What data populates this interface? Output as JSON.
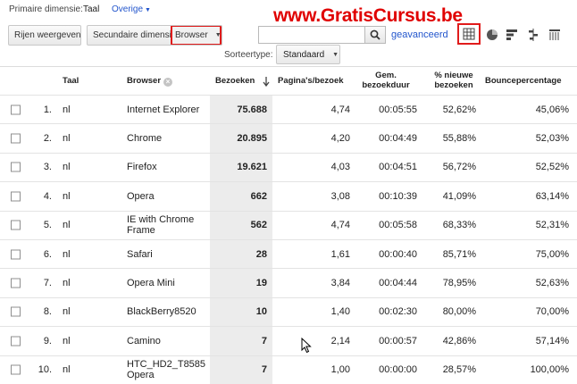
{
  "dimension_bar": {
    "label": "Primaire dimensie:",
    "current": "Taal",
    "other": "Overige"
  },
  "watermark": "www.GratisCursus.be",
  "toolbar": {
    "rows_button": "Rijen weergeven",
    "secondary_label": "Secundaire dimensie",
    "secondary_value": "Browser",
    "search_placeholder": "",
    "advanced_link": "geavanceerd",
    "sort_label": "Sorteertype:",
    "sort_value": "Standaard"
  },
  "table": {
    "headers": {
      "taal": "Taal",
      "browser": "Browser",
      "bezoeken": "Bezoeken",
      "paginas": "Pagina's/bezoek",
      "duur": "Gem. bezoekduur",
      "nieuw": "% nieuwe bezoeken",
      "bounce": "Bouncepercentage"
    },
    "rows": [
      {
        "idx": "1.",
        "taal": "nl",
        "browser": "Internet Explorer",
        "bezoeken": "75.688",
        "paginas": "4,74",
        "duur": "00:05:55",
        "nieuw": "52,62%",
        "bounce": "45,06%"
      },
      {
        "idx": "2.",
        "taal": "nl",
        "browser": "Chrome",
        "bezoeken": "20.895",
        "paginas": "4,20",
        "duur": "00:04:49",
        "nieuw": "55,88%",
        "bounce": "52,03%"
      },
      {
        "idx": "3.",
        "taal": "nl",
        "browser": "Firefox",
        "bezoeken": "19.621",
        "paginas": "4,03",
        "duur": "00:04:51",
        "nieuw": "56,72%",
        "bounce": "52,52%"
      },
      {
        "idx": "4.",
        "taal": "nl",
        "browser": "Opera",
        "bezoeken": "662",
        "paginas": "3,08",
        "duur": "00:10:39",
        "nieuw": "41,09%",
        "bounce": "63,14%"
      },
      {
        "idx": "5.",
        "taal": "nl",
        "browser": "IE with Chrome Frame",
        "bezoeken": "562",
        "paginas": "4,74",
        "duur": "00:05:58",
        "nieuw": "68,33%",
        "bounce": "52,31%"
      },
      {
        "idx": "6.",
        "taal": "nl",
        "browser": "Safari",
        "bezoeken": "28",
        "paginas": "1,61",
        "duur": "00:00:40",
        "nieuw": "85,71%",
        "bounce": "75,00%"
      },
      {
        "idx": "7.",
        "taal": "nl",
        "browser": "Opera Mini",
        "bezoeken": "19",
        "paginas": "3,84",
        "duur": "00:04:44",
        "nieuw": "78,95%",
        "bounce": "52,63%"
      },
      {
        "idx": "8.",
        "taal": "nl",
        "browser": "BlackBerry8520",
        "bezoeken": "10",
        "paginas": "1,40",
        "duur": "00:02:30",
        "nieuw": "80,00%",
        "bounce": "70,00%"
      },
      {
        "idx": "9.",
        "taal": "nl",
        "browser": "Camino",
        "bezoeken": "7",
        "paginas": "2,14",
        "duur": "00:00:57",
        "nieuw": "42,86%",
        "bounce": "57,14%"
      },
      {
        "idx": "10.",
        "taal": "nl",
        "browser": "HTC_HD2_T8585 Opera",
        "bezoeken": "7",
        "paginas": "1,00",
        "duur": "00:00:00",
        "nieuw": "28,57%",
        "bounce": "100,00%"
      }
    ]
  },
  "colors": {
    "link": "#2255cc",
    "highlight": "#e01b1b",
    "watermark": "#e00000",
    "shade": "#ececec"
  },
  "icons": {
    "search": "magnifier-icon",
    "views": [
      "table-grid-icon",
      "pie-chart-icon",
      "bar-chart-icon",
      "comparison-icon",
      "pivot-icon"
    ],
    "remove": "remove-dimension-icon",
    "sort": "sort-arrow-down-icon"
  }
}
